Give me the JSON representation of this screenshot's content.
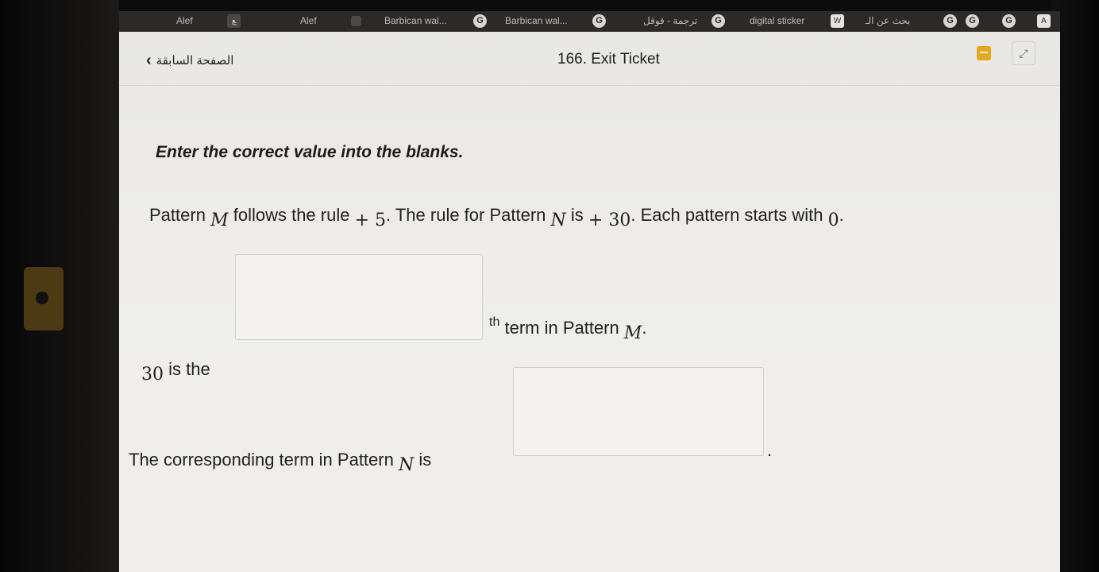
{
  "bookmarks": [
    {
      "label": "Alef",
      "icon": "alef-icon"
    },
    {
      "label": "Alef",
      "icon": "alef-logo-icon"
    },
    {
      "label": "Barbican wal...",
      "icon": "google-icon"
    },
    {
      "label": "Barbican wal...",
      "icon": "google-icon"
    },
    {
      "label": "ترجمة - قوقل",
      "icon": "google-icon"
    },
    {
      "label": "digital sticker",
      "icon": "word-icon"
    },
    {
      "label": "بحث عن الـ",
      "icon": "google-icon"
    }
  ],
  "header": {
    "back_label": "الصفحة السابقة",
    "title": "166. Exit Ticket"
  },
  "question": {
    "instruction": "Enter the correct value into the blanks.",
    "line1": {
      "t1": "Pattern",
      "var_m": "M",
      "t2": "follows the rule",
      "rule_m": "+ 5",
      "t3": ". The rule for Pattern",
      "var_n": "N",
      "t4": "is",
      "rule_n": "+ 30",
      "t5": ". Each pattern starts with",
      "start": "0",
      "t6": "."
    },
    "line2": {
      "num": "30",
      "t1": "is the",
      "sup": "th",
      "t2": "term in Pattern",
      "var_m": "M",
      "t3": "."
    },
    "line3": {
      "t1": "The corresponding term in Pattern",
      "var_n": "N",
      "t2": "is",
      "t3": "."
    },
    "blank1_value": "",
    "blank2_value": ""
  }
}
